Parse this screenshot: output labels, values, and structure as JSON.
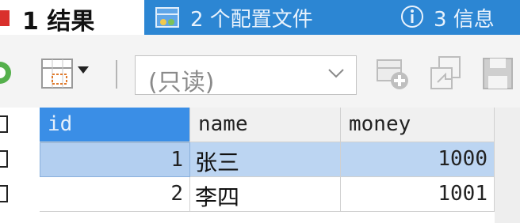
{
  "tabs": [
    {
      "label": "1 结果",
      "active": true,
      "icon": "result-icon"
    },
    {
      "label": "2 个配置文件",
      "active": false,
      "icon": "profile-icon"
    },
    {
      "label": "3 信息",
      "active": false,
      "icon": "info-icon"
    }
  ],
  "toolbar": {
    "mode_value": "(只读)",
    "icons": [
      "export-icon",
      "grid-layout-icon",
      "add-row-icon",
      "copy-row-icon",
      "save-icon"
    ]
  },
  "grid": {
    "columns": [
      "id",
      "name",
      "money"
    ],
    "rows": [
      {
        "id": "1",
        "name": "张三",
        "money": "1000",
        "selected": true
      },
      {
        "id": "2",
        "name": "李四",
        "money": "1001",
        "selected": false
      }
    ]
  },
  "colors": {
    "tab_bar": "#2c86d3",
    "selected_header": "#3a8ee6",
    "selected_row": "#bcd5f2",
    "result_icon": "#d9302c"
  }
}
